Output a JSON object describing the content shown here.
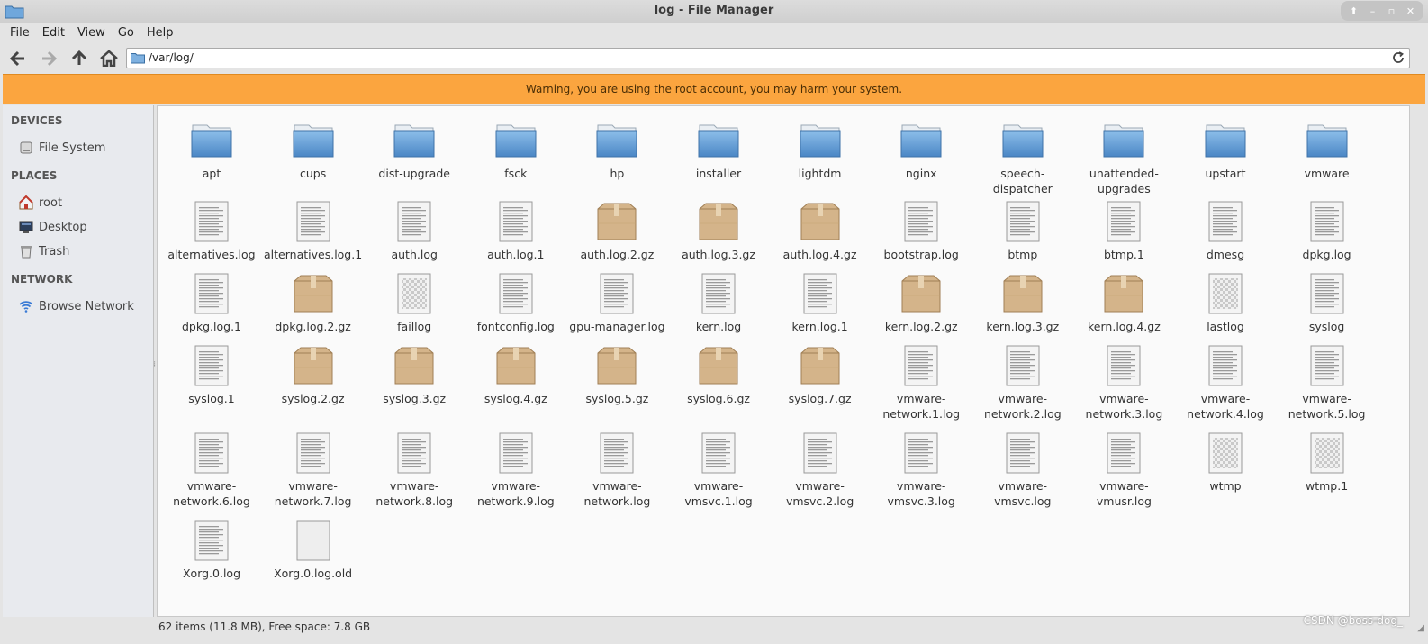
{
  "window": {
    "title": "log - File Manager"
  },
  "menu": [
    "File",
    "Edit",
    "View",
    "Go",
    "Help"
  ],
  "toolbar": {
    "path": "/var/log/"
  },
  "warning": "Warning, you are using the root account, you may harm your system.",
  "sidebar": {
    "sections": [
      {
        "title": "DEVICES",
        "items": [
          {
            "label": "File System",
            "icon": "drive-icon"
          }
        ]
      },
      {
        "title": "PLACES",
        "items": [
          {
            "label": "root",
            "icon": "home-icon"
          },
          {
            "label": "Desktop",
            "icon": "desktop-icon"
          },
          {
            "label": "Trash",
            "icon": "trash-icon"
          }
        ]
      },
      {
        "title": "NETWORK",
        "items": [
          {
            "label": "Browse Network",
            "icon": "network-icon"
          }
        ]
      }
    ]
  },
  "files": [
    {
      "name": "apt",
      "type": "folder"
    },
    {
      "name": "cups",
      "type": "folder"
    },
    {
      "name": "dist-upgrade",
      "type": "folder"
    },
    {
      "name": "fsck",
      "type": "folder"
    },
    {
      "name": "hp",
      "type": "folder"
    },
    {
      "name": "installer",
      "type": "folder"
    },
    {
      "name": "lightdm",
      "type": "folder"
    },
    {
      "name": "nginx",
      "type": "folder"
    },
    {
      "name": "speech-dispatcher",
      "type": "folder"
    },
    {
      "name": "unattended-upgrades",
      "type": "folder"
    },
    {
      "name": "upstart",
      "type": "folder"
    },
    {
      "name": "vmware",
      "type": "folder"
    },
    {
      "name": "alternatives.log",
      "type": "text"
    },
    {
      "name": "alternatives.log.1",
      "type": "text"
    },
    {
      "name": "auth.log",
      "type": "text"
    },
    {
      "name": "auth.log.1",
      "type": "text"
    },
    {
      "name": "auth.log.2.gz",
      "type": "archive"
    },
    {
      "name": "auth.log.3.gz",
      "type": "archive"
    },
    {
      "name": "auth.log.4.gz",
      "type": "archive"
    },
    {
      "name": "bootstrap.log",
      "type": "text"
    },
    {
      "name": "btmp",
      "type": "text"
    },
    {
      "name": "btmp.1",
      "type": "text"
    },
    {
      "name": "dmesg",
      "type": "text"
    },
    {
      "name": "dpkg.log",
      "type": "text"
    },
    {
      "name": "dpkg.log.1",
      "type": "text"
    },
    {
      "name": "dpkg.log.2.gz",
      "type": "archive"
    },
    {
      "name": "faillog",
      "type": "binary"
    },
    {
      "name": "fontconfig.log",
      "type": "text"
    },
    {
      "name": "gpu-manager.log",
      "type": "text"
    },
    {
      "name": "kern.log",
      "type": "text"
    },
    {
      "name": "kern.log.1",
      "type": "text"
    },
    {
      "name": "kern.log.2.gz",
      "type": "archive"
    },
    {
      "name": "kern.log.3.gz",
      "type": "archive"
    },
    {
      "name": "kern.log.4.gz",
      "type": "archive"
    },
    {
      "name": "lastlog",
      "type": "binary"
    },
    {
      "name": "syslog",
      "type": "text"
    },
    {
      "name": "syslog.1",
      "type": "text"
    },
    {
      "name": "syslog.2.gz",
      "type": "archive"
    },
    {
      "name": "syslog.3.gz",
      "type": "archive"
    },
    {
      "name": "syslog.4.gz",
      "type": "archive"
    },
    {
      "name": "syslog.5.gz",
      "type": "archive"
    },
    {
      "name": "syslog.6.gz",
      "type": "archive"
    },
    {
      "name": "syslog.7.gz",
      "type": "archive"
    },
    {
      "name": "vmware-network.1.log",
      "type": "text"
    },
    {
      "name": "vmware-network.2.log",
      "type": "text"
    },
    {
      "name": "vmware-network.3.log",
      "type": "text"
    },
    {
      "name": "vmware-network.4.log",
      "type": "text"
    },
    {
      "name": "vmware-network.5.log",
      "type": "text"
    },
    {
      "name": "vmware-network.6.log",
      "type": "text"
    },
    {
      "name": "vmware-network.7.log",
      "type": "text"
    },
    {
      "name": "vmware-network.8.log",
      "type": "text"
    },
    {
      "name": "vmware-network.9.log",
      "type": "text"
    },
    {
      "name": "vmware-network.log",
      "type": "text"
    },
    {
      "name": "vmware-vmsvc.1.log",
      "type": "text"
    },
    {
      "name": "vmware-vmsvc.2.log",
      "type": "text"
    },
    {
      "name": "vmware-vmsvc.3.log",
      "type": "text"
    },
    {
      "name": "vmware-vmsvc.log",
      "type": "text"
    },
    {
      "name": "vmware-vmusr.log",
      "type": "text"
    },
    {
      "name": "wtmp",
      "type": "binary"
    },
    {
      "name": "wtmp.1",
      "type": "binary"
    },
    {
      "name": "Xorg.0.log",
      "type": "text"
    },
    {
      "name": "Xorg.0.log.old",
      "type": "blank"
    }
  ],
  "status": "62 items (11.8 MB), Free space: 7.8 GB",
  "watermark": "CSDN @boss-dog_",
  "colors": {
    "warning_bg": "#fba53f",
    "folder": "#5a9ad6",
    "archive": "#c9a878"
  }
}
